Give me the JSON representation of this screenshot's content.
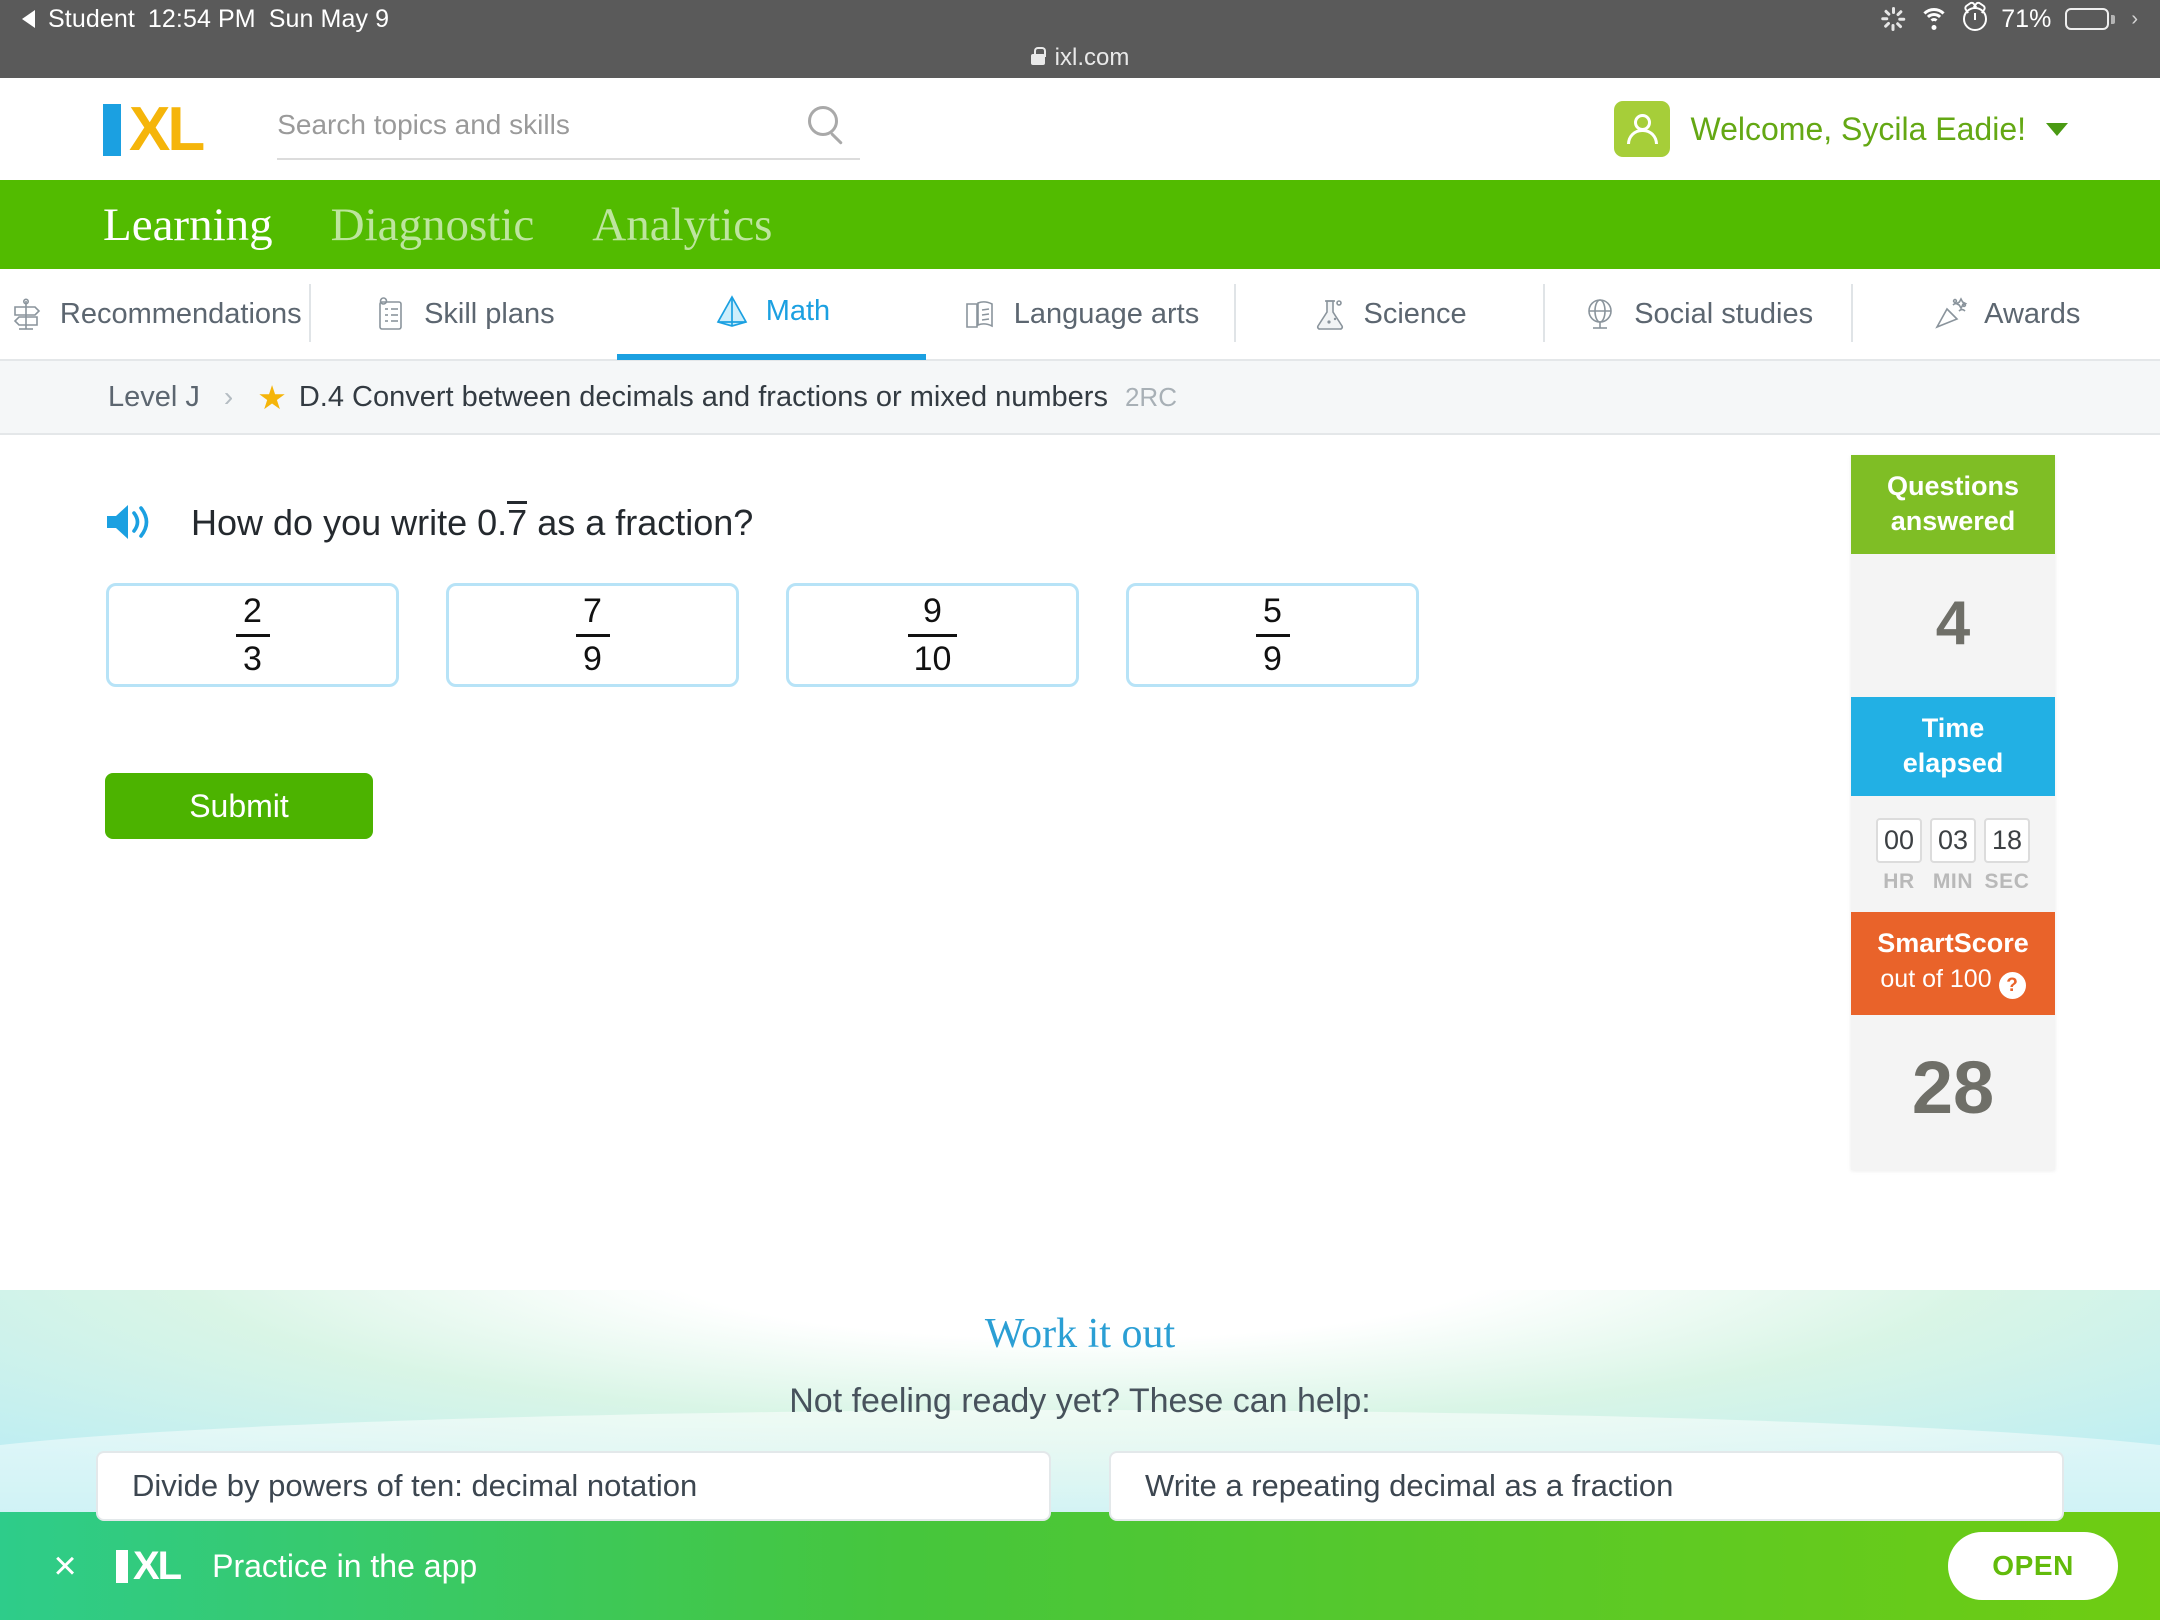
{
  "status_bar": {
    "back_label": "Student",
    "time": "12:54 PM",
    "date": "Sun May 9",
    "battery": "71%"
  },
  "browser": {
    "url": "ixl.com"
  },
  "header": {
    "logo_i": "I",
    "logo_xl": "XL",
    "search_placeholder": "Search topics and skills",
    "search_value": "",
    "welcome": "Welcome, Sycila Eadie!"
  },
  "main_nav": {
    "items": [
      {
        "label": "Learning",
        "active": true
      },
      {
        "label": "Diagnostic",
        "active": false
      },
      {
        "label": "Analytics",
        "active": false
      }
    ]
  },
  "subject_tabs": [
    {
      "label": "Recommendations",
      "icon": "signpost-icon",
      "active": false
    },
    {
      "label": "Skill plans",
      "icon": "clipboard-icon",
      "active": false
    },
    {
      "label": "Math",
      "icon": "pyramid-icon",
      "active": true
    },
    {
      "label": "Language arts",
      "icon": "open-book-icon",
      "active": false
    },
    {
      "label": "Science",
      "icon": "flask-icon",
      "active": false
    },
    {
      "label": "Social studies",
      "icon": "globe-icon",
      "active": false
    },
    {
      "label": "Awards",
      "icon": "party-popper-icon",
      "active": false
    }
  ],
  "breadcrumb": {
    "level": "Level J",
    "separator": "›",
    "star": "★",
    "skill": "D.4 Convert between decimals and fractions or mixed numbers",
    "code": "2RC"
  },
  "question": {
    "prompt_before": "How do you write 0.",
    "repeating_digit": "7",
    "prompt_after": " as a fraction?",
    "choices": [
      {
        "numerator": "2",
        "denominator": "3"
      },
      {
        "numerator": "7",
        "denominator": "9"
      },
      {
        "numerator": "9",
        "denominator": "10"
      },
      {
        "numerator": "5",
        "denominator": "9"
      }
    ],
    "submit_label": "Submit"
  },
  "score_panel": {
    "questions": {
      "title_line1": "Questions",
      "title_line2": "answered",
      "value": "4",
      "color": "#7fbe25"
    },
    "time": {
      "title_line1": "Time",
      "title_line2": "elapsed",
      "hours": "00",
      "minutes": "03",
      "seconds": "18",
      "hr_label": "HR",
      "min_label": "MIN",
      "sec_label": "SEC",
      "color": "#22b0e4"
    },
    "smartscore": {
      "title": "SmartScore",
      "subtitle": "out of 100",
      "help_glyph": "?",
      "value": "28",
      "color": "#e9632a"
    }
  },
  "work_it_out": {
    "title": "Work it out",
    "subtitle": "Not feeling ready yet? These can help:",
    "cards": [
      "Divide by powers of ten: decimal notation",
      "Write a repeating decimal as a fraction"
    ]
  },
  "app_banner": {
    "close_glyph": "×",
    "logo_i": "I",
    "logo_xl": "XL",
    "text": "Practice in the app",
    "open_label": "OPEN"
  }
}
